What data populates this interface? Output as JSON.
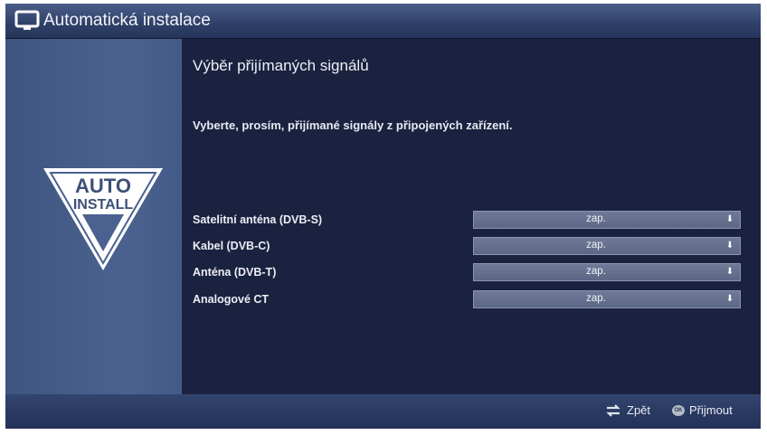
{
  "window": {
    "title": "Automatická instalace"
  },
  "logo": {
    "line1": "AUTO",
    "line2": "INSTALL"
  },
  "main": {
    "heading": "Výběr přijímaných signálů",
    "instruction": "Vyberte, prosím, přijímané signály z připojených zařízení.",
    "rows": [
      {
        "label": "Satelitní anténa (DVB-S)",
        "value": "zap."
      },
      {
        "label": "Kabel (DVB-C)",
        "value": "zap."
      },
      {
        "label": "Anténa (DVB-T)",
        "value": "zap."
      },
      {
        "label": "Analogové CT",
        "value": "zap."
      }
    ]
  },
  "footer": {
    "back_label": "Zpět",
    "accept_label": "Přijmout",
    "ok_key": "OK"
  },
  "colors": {
    "panel": "#1c2340",
    "sidebar": "#4b6290",
    "titlebar": "#2f4068",
    "select": "#6f7a98"
  },
  "icons": [
    "tv-icon",
    "back-icon",
    "ok-icon",
    "dropdown-arrow-icon"
  ]
}
